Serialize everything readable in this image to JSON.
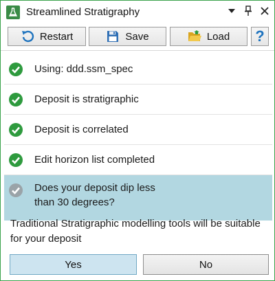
{
  "window": {
    "title": "Streamlined Stratigraphy",
    "icon": "flask-icon",
    "controls": [
      "dropdown-icon",
      "pin-icon",
      "close-icon"
    ]
  },
  "toolbar": {
    "restart_label": "Restart",
    "save_label": "Save",
    "load_label": "Load",
    "help_label": "?"
  },
  "steps": [
    {
      "label": "Using: ddd.ssm_spec",
      "status": "complete",
      "icon": "check-circle-icon"
    },
    {
      "label": "Deposit is stratigraphic",
      "status": "complete",
      "icon": "check-circle-icon"
    },
    {
      "label": "Deposit is correlated",
      "status": "complete",
      "icon": "check-circle-icon"
    },
    {
      "label": "Edit horizon list completed",
      "status": "complete",
      "icon": "check-circle-icon"
    },
    {
      "label_line1": "Does your deposit dip less",
      "label_line2": "than 30 degrees?",
      "status": "active",
      "icon": "check-circle-grey-icon"
    }
  ],
  "prompt": {
    "line1": "Traditional Stratigraphic modelling tools will be suitable",
    "line2": "for your deposit"
  },
  "answers": {
    "yes_label": "Yes",
    "no_label": "No"
  },
  "colors": {
    "accent_green": "#3a8b46",
    "check_green": "#2e9a3e",
    "active_row": "#b2d7e1",
    "inactive_check": "#9aa3a8"
  }
}
